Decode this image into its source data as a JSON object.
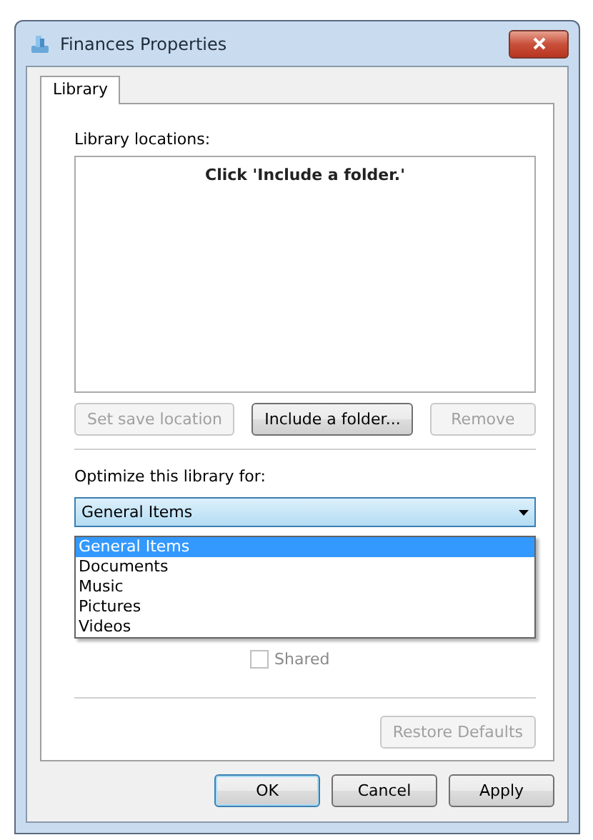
{
  "window": {
    "title": "Finances Properties"
  },
  "tabs": [
    {
      "label": "Library",
      "selected": true
    }
  ],
  "locations": {
    "label": "Library locations:",
    "hint": "Click 'Include a folder.'"
  },
  "location_buttons": [
    {
      "label": "Set save location",
      "disabled": true,
      "default": false
    },
    {
      "label": "Include a folder...",
      "disabled": false,
      "default": false
    },
    {
      "label": "Remove",
      "disabled": true,
      "default": false
    }
  ],
  "optimize": {
    "label": "Optimize this library for:",
    "value": "General Items",
    "expanded": true,
    "options": [
      {
        "label": "General Items",
        "selected": true
      },
      {
        "label": "Documents",
        "selected": false
      },
      {
        "label": "Music",
        "selected": false
      },
      {
        "label": "Pictures",
        "selected": false
      },
      {
        "label": "Videos",
        "selected": false
      }
    ]
  },
  "shared": {
    "label": "Shared",
    "checked": false,
    "disabled": true
  },
  "restore_button": {
    "label": "Restore Defaults",
    "disabled": true
  },
  "dialog_buttons": [
    {
      "label": "OK",
      "disabled": false,
      "default": true
    },
    {
      "label": "Cancel",
      "disabled": false,
      "default": false
    },
    {
      "label": "Apply",
      "disabled": false,
      "default": false
    }
  ]
}
